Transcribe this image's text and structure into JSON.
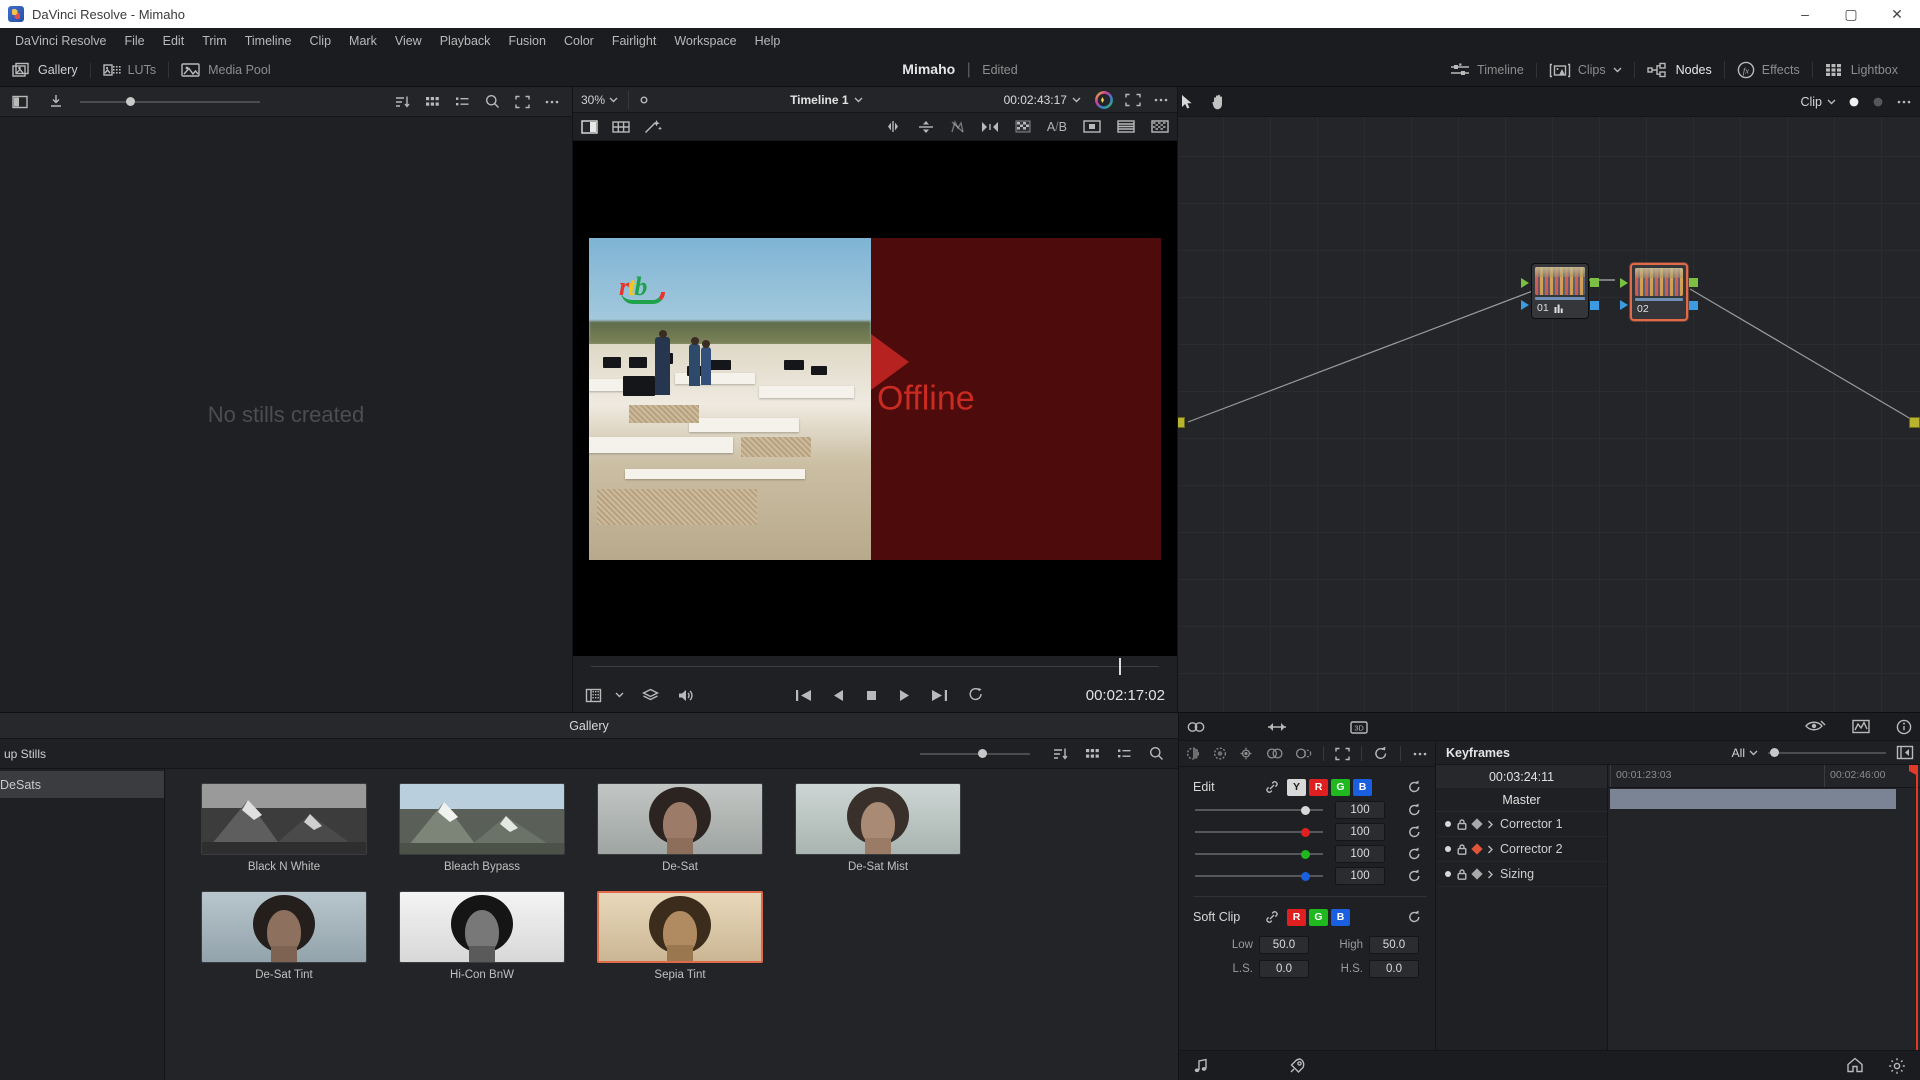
{
  "window": {
    "title": "DaVinci Resolve - Mimaho",
    "minimize": "–",
    "maximize": "▢",
    "close": "✕"
  },
  "menubar": {
    "items": [
      "DaVinci Resolve",
      "File",
      "Edit",
      "Trim",
      "Timeline",
      "Clip",
      "Mark",
      "View",
      "Playback",
      "Fusion",
      "Color",
      "Fairlight",
      "Workspace",
      "Help"
    ]
  },
  "toolbar": {
    "left_items": [
      {
        "label": "Gallery",
        "icon": "gallery-icon"
      },
      {
        "label": "LUTs",
        "icon": "luts-icon"
      },
      {
        "label": "Media Pool",
        "icon": "media-pool-icon"
      }
    ],
    "project_name": "Mimaho",
    "separator": "|",
    "project_status": "Edited",
    "right_items": [
      {
        "label": "Timeline",
        "icon": "timeline-icon"
      },
      {
        "label": "Clips",
        "icon": "clips-icon"
      },
      {
        "label": "Nodes",
        "icon": "nodes-icon"
      },
      {
        "label": "Effects",
        "icon": "effects-fx-icon"
      },
      {
        "label": "Lightbox",
        "icon": "lightbox-icon"
      }
    ]
  },
  "left_panel": {
    "empty_text": "No stills created"
  },
  "viewer": {
    "zoom_level": "30%",
    "timeline_name": "Timeline 1",
    "timecode_top": "00:02:43:17",
    "offline_label": "Offline",
    "watermark": {
      "r": "r",
      "t": "t",
      "b": "b"
    },
    "current_timecode": "00:02:17:02"
  },
  "nodes": {
    "scope_label": "Clip",
    "list": [
      {
        "number": "01",
        "selected": false,
        "has_scope_icon": true
      },
      {
        "number": "02",
        "selected": true,
        "has_scope_icon": false
      }
    ]
  },
  "gallery": {
    "window_title": "Gallery",
    "sidebar": [
      {
        "label": "up Stills",
        "active": false
      },
      {
        "label": "DeSats",
        "active": true
      }
    ],
    "stills": [
      {
        "caption": "Black N White",
        "kind": "mountain",
        "selected": false
      },
      {
        "caption": "Bleach Bypass",
        "kind": "mountain",
        "selected": false
      },
      {
        "caption": "De-Sat",
        "kind": "face",
        "selected": false
      },
      {
        "caption": "De-Sat Mist",
        "kind": "face",
        "selected": false
      },
      {
        "caption": "De-Sat Tint",
        "kind": "face",
        "selected": false
      },
      {
        "caption": "Hi-Con BnW",
        "kind": "face",
        "selected": false
      },
      {
        "caption": "Sepia Tint",
        "kind": "face",
        "selected": true
      }
    ]
  },
  "inspector": {
    "edit": {
      "title": "Edit",
      "channels": [
        "Y",
        "R",
        "G",
        "B"
      ],
      "values": [
        "100",
        "100",
        "100",
        "100"
      ]
    },
    "soft_clip": {
      "title": "Soft Clip",
      "channels": [
        "R",
        "G",
        "B"
      ],
      "fields": [
        {
          "label": "Low",
          "value": "50.0"
        },
        {
          "label": "High",
          "value": "50.0"
        },
        {
          "label": "L.S.",
          "value": "0.0"
        },
        {
          "label": "H.S.",
          "value": "0.0"
        }
      ]
    }
  },
  "keyframes": {
    "title": "Keyframes",
    "filter": "All",
    "timecode": "00:03:24:11",
    "ruler_labels": [
      "00:01:23:03",
      "00:02:46:00"
    ],
    "master_label": "Master",
    "tracks": [
      {
        "label": "Corrector 1",
        "keyframe_color": "grey"
      },
      {
        "label": "Corrector 2",
        "keyframe_color": "red"
      },
      {
        "label": "Sizing",
        "keyframe_color": "grey"
      }
    ]
  },
  "colors": {
    "accent_orange": "#e06a4a",
    "red": "#e02020",
    "green": "#1fb81f",
    "blue": "#1a5fe0",
    "playhead_red": "#e03a2a",
    "offline_bg": "#4e0b0b"
  }
}
